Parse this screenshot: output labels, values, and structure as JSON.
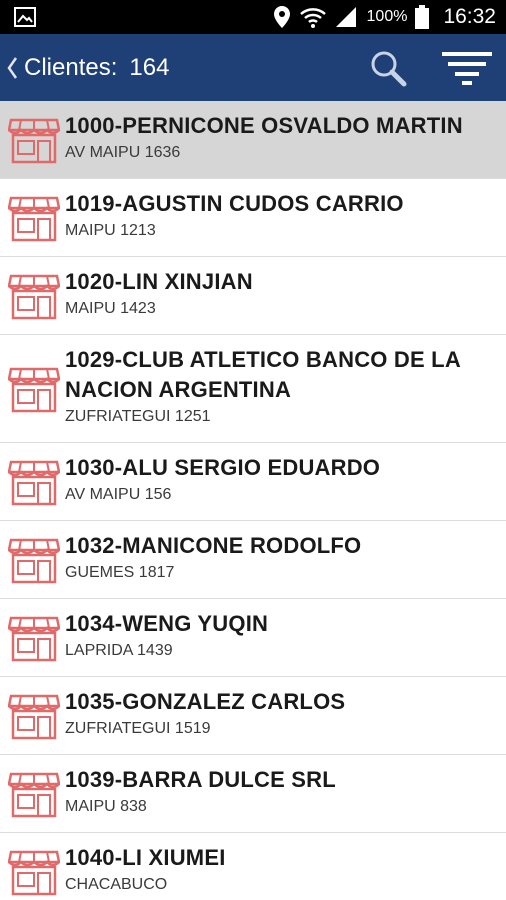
{
  "status_bar": {
    "icons": [
      "image-icon",
      "location-icon",
      "wifi-icon",
      "signal-icon",
      "battery-icon"
    ],
    "battery": "100%",
    "time": "16:32"
  },
  "app_bar": {
    "title": "Clientes:",
    "count": "164",
    "icons": [
      "back-chevron-icon",
      "search-icon",
      "filter-icon"
    ],
    "color": "#1f3f77"
  },
  "clients": [
    {
      "name": "1000-PERNICONE OSVALDO MARTIN",
      "address": "AV MAIPU 1636",
      "selected": true
    },
    {
      "name": "1019-AGUSTIN CUDOS CARRIO",
      "address": "MAIPU 1213"
    },
    {
      "name": "1020-LIN XINJIAN",
      "address": "MAIPU 1423"
    },
    {
      "name": "1029-CLUB ATLETICO BANCO DE LA NACION ARGENTINA",
      "address": "ZUFRIATEGUI 1251"
    },
    {
      "name": "1030-ALU SERGIO EDUARDO",
      "address": "AV MAIPU 156"
    },
    {
      "name": "1032-MANICONE RODOLFO",
      "address": "GUEMES 1817"
    },
    {
      "name": "1034-WENG YUQIN",
      "address": "LAPRIDA 1439"
    },
    {
      "name": "1035-GONZALEZ CARLOS",
      "address": "ZUFRIATEGUI 1519"
    },
    {
      "name": "1039-BARRA DULCE SRL",
      "address": "MAIPU 838"
    },
    {
      "name": "1040-LI XIUMEI",
      "address": "CHACABUCO"
    }
  ],
  "row_icon": "store-icon",
  "store_icon_color": "#e06a6a",
  "selected_row_color": "#d6d6d6"
}
